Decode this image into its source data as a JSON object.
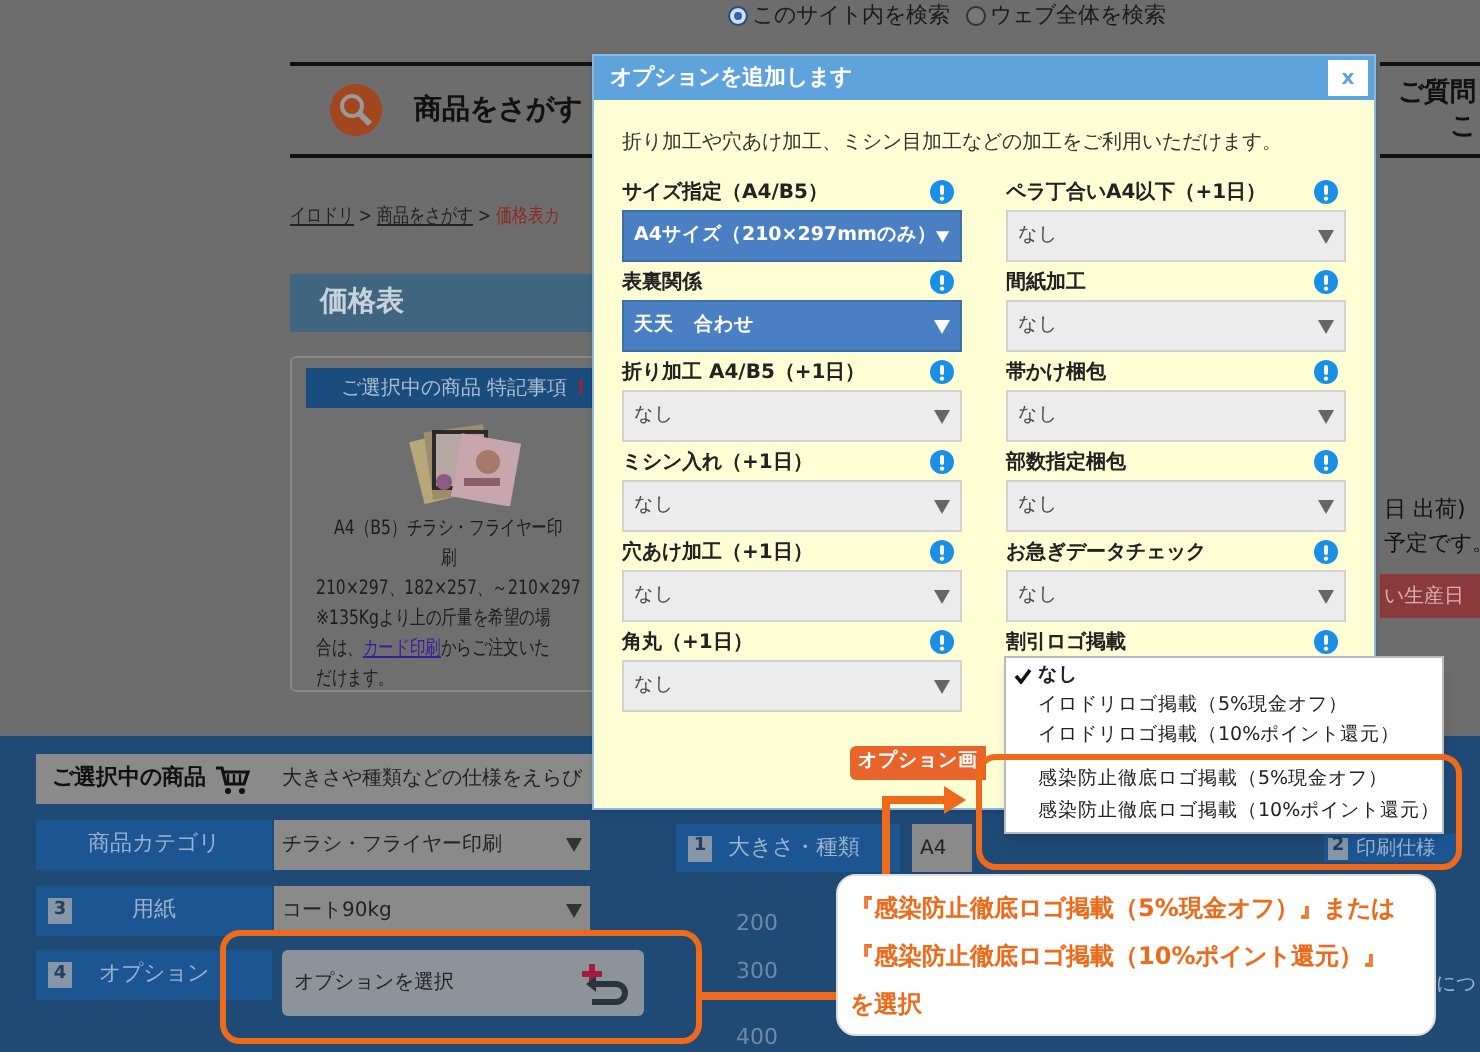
{
  "search_scope": [
    {
      "label": "このサイト内を検索",
      "selected": true
    },
    {
      "label": "ウェブ全体を検索",
      "selected": false
    }
  ],
  "search_banner": {
    "label": "商品をさがす"
  },
  "help_banner": {
    "lines": [
      "ご質問",
      "こ"
    ]
  },
  "breadcrumb": [
    {
      "label": "イロドリ",
      "kind": "link"
    },
    {
      "label": "商品をさがす",
      "kind": "link"
    },
    {
      "label": "価格表カ",
      "kind": "current"
    }
  ],
  "breadcrumb_separator": ">",
  "price_heading": "価格表",
  "notes_card": {
    "header": "ご選択中の商品 特記事項",
    "header_mark": "！",
    "name_lines": [
      "A4（B5）チラシ・フライヤー印",
      "刷"
    ],
    "size_text": "210×297、182×257、～210×297",
    "note_lines": [
      [
        {
          "text": "※135Kgより上の斤量を希望の場",
          "kind": "plain"
        }
      ],
      [
        {
          "text": "合は、",
          "kind": "plain"
        },
        {
          "text": "カード印刷",
          "kind": "link"
        },
        {
          "text": "からご注文いた",
          "kind": "plain"
        }
      ],
      [
        {
          "text": "だけます。",
          "kind": "plain"
        }
      ]
    ]
  },
  "shipping_lines": [
    "日 出荷)",
    "予定です。"
  ],
  "notice_button": "い生産日",
  "selected_product": {
    "title": "ご選択中の商品",
    "hint": "大きさや種類などの仕様をえらび",
    "rows": [
      {
        "label": "商品カテゴリ",
        "value": "チラシ・フライヤー印刷",
        "kind": "select"
      },
      {
        "number": "3",
        "label": "用紙",
        "value": "コート90kg",
        "kind": "select"
      },
      {
        "number": "4",
        "label": "オプション",
        "value": "オプションを選択",
        "kind": "button"
      }
    ]
  },
  "spec_steps": [
    {
      "number": "1",
      "label": "大きさ・種類",
      "value": "A4"
    },
    {
      "number": "2",
      "label": "印刷仕様"
    }
  ],
  "quantity_column": [
    "200",
    "300",
    "400"
  ],
  "side_text": "につ",
  "modal": {
    "title": "オプションを追加します",
    "close": "x",
    "description": "折り加工や穴あけ加工、ミシン目加工などの加工をご利用いただけます。",
    "columns": [
      [
        {
          "label": "サイズ指定（A4/B5）",
          "value": "A4サイズ（210×297mmのみ）",
          "highlighted": true,
          "expanded": false
        },
        {
          "label": "表裏関係",
          "value": "天天　合わせ",
          "highlighted": true,
          "expanded": false
        },
        {
          "label": "折り加工 A4/B5（+1日）",
          "value": "なし",
          "highlighted": false,
          "expanded": false
        },
        {
          "label": "ミシン入れ（+1日）",
          "value": "なし",
          "highlighted": false,
          "expanded": false
        },
        {
          "label": "穴あけ加工（+1日）",
          "value": "なし",
          "highlighted": false,
          "expanded": false
        },
        {
          "label": "角丸（+1日）",
          "value": "なし",
          "highlighted": false,
          "expanded": false
        }
      ],
      [
        {
          "label": "ペラ丁合いA4以下（+1日）",
          "value": "なし",
          "highlighted": false,
          "expanded": false
        },
        {
          "label": "間紙加工",
          "value": "なし",
          "highlighted": false,
          "expanded": false
        },
        {
          "label": "帯かけ梱包",
          "value": "なし",
          "highlighted": false,
          "expanded": false
        },
        {
          "label": "部数指定梱包",
          "value": "なし",
          "highlighted": false,
          "expanded": false
        },
        {
          "label": "お急ぎデータチェック",
          "value": "なし",
          "highlighted": false,
          "expanded": false
        },
        {
          "label": "割引ロゴ掲載",
          "highlighted": false,
          "expanded": true,
          "options": [
            {
              "label": "なし",
              "selected": true
            },
            {
              "label": "イロドリロゴ掲載（5%現金オフ）",
              "selected": false
            },
            {
              "label": "イロドリロゴ掲載（10%ポイント還元）",
              "selected": false
            },
            {
              "label": "感染防止徹底ロゴ掲載（5%現金オフ）",
              "selected": false
            },
            {
              "label": "感染防止徹底ロゴ掲載（10%ポイント還元）",
              "selected": false
            }
          ]
        }
      ]
    ]
  },
  "highlight_tag": "オプション画",
  "callout": {
    "lines": [
      "『感染防止徹底ロゴ掲載（5%現金オフ）』または",
      "『感染防止徹底ロゴ掲載（10%ポイント還元）』",
      "を選択"
    ]
  }
}
